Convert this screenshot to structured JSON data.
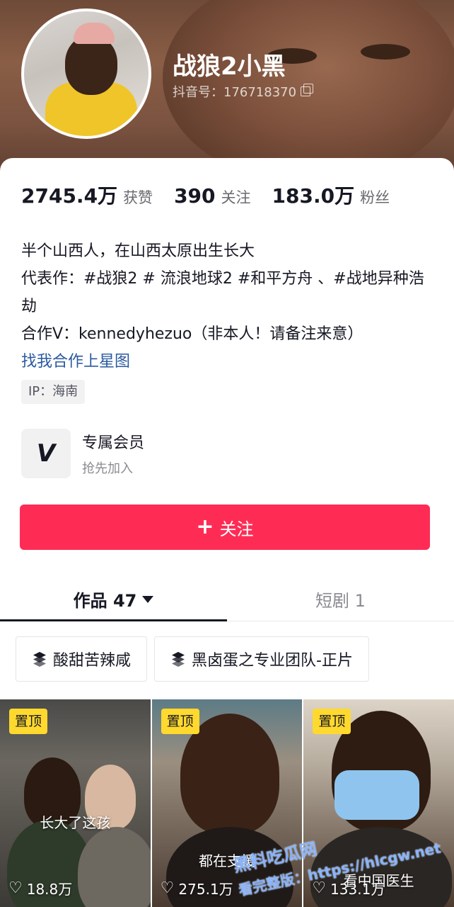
{
  "profile": {
    "name": "战狼2小黑",
    "douyin_id": "抖音号：176718370"
  },
  "stats": [
    {
      "value": "2745.4万",
      "label": "获赞"
    },
    {
      "value": "390",
      "label": "关注"
    },
    {
      "value": "183.0万",
      "label": "粉丝"
    }
  ],
  "bio": {
    "line1": "半个山西人，在山西太原出生长大",
    "line2": "代表作：#战狼2 # 流浪地球2 #和平方舟 、#战地异种浩劫",
    "line3": "合作V：kennedyhezuo（非本人！请备注来意）",
    "link": "找我合作上星图"
  },
  "ip_tag": "IP：海南",
  "member": {
    "title": "专属会员",
    "subtitle": "抢先加入",
    "icon": "v-logo-icon"
  },
  "follow_button": {
    "label": "关注",
    "color": "#fe2c55"
  },
  "tabs": [
    {
      "label": "作品 47",
      "active": true
    },
    {
      "label": "短剧 1",
      "active": false
    }
  ],
  "chips": [
    {
      "label": "酸甜苦辣咸",
      "icon": "layers-icon"
    },
    {
      "label": "黑卤蛋之专业团队-正片",
      "icon": "layers-icon"
    }
  ],
  "videos": [
    {
      "pinned": "置顶",
      "caption": "长大了这孩",
      "likes": "18.8万"
    },
    {
      "pinned": "置顶",
      "caption": "都在支援",
      "likes": "275.1万"
    },
    {
      "pinned": "置顶",
      "caption": "看中国医生",
      "likes": "133.1万"
    }
  ],
  "watermark": {
    "line1": "黑料吃瓜网",
    "line2": "看完整版：https://hlcgw.net"
  }
}
